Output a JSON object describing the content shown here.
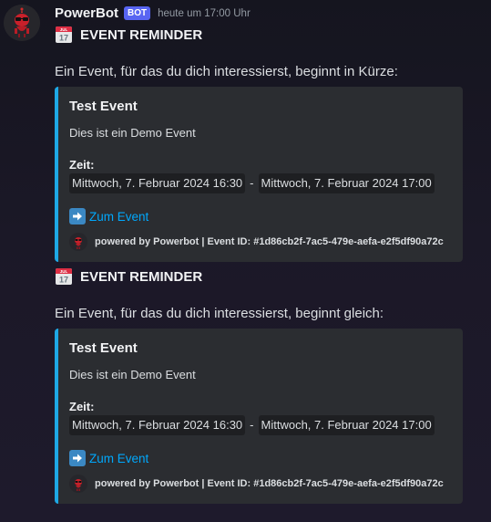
{
  "message": {
    "author": "PowerBot",
    "bot_tag": "BOT",
    "timestamp": "heute um 17:00 Uhr",
    "avatar_icon": "robot-mascot-icon"
  },
  "reminders": [
    {
      "heading": "EVENT REMINDER",
      "intro": "Ein Event, für das du dich interessierst, beginnt in Kürze:",
      "embed": {
        "accent_color": "#1ea8e5",
        "title": "Test Event",
        "description": "Dies ist ein Demo Event",
        "field_name": "Zeit:",
        "start": "Mittwoch, 7. Februar 2024 16:30",
        "separator": "-",
        "end": "Mittwoch, 7. Februar 2024 17:00",
        "link_label": "Zum Event",
        "footer": "powered by Powerbot | Event ID: #1d86cb2f-7ac5-479e-aefa-e2f5df90a72c"
      }
    },
    {
      "heading": "EVENT REMINDER",
      "intro": "Ein Event, für das du dich interessierst, beginnt gleich:",
      "embed": {
        "accent_color": "#1ea8e5",
        "title": "Test Event",
        "description": "Dies ist ein Demo Event",
        "field_name": "Zeit:",
        "start": "Mittwoch, 7. Februar 2024 16:30",
        "separator": "-",
        "end": "Mittwoch, 7. Februar 2024 17:00",
        "link_label": "Zum Event",
        "footer": "powered by Powerbot | Event ID: #1d86cb2f-7ac5-479e-aefa-e2f5df90a72c"
      }
    }
  ],
  "calendar_icon": {
    "name": "calendar-icon",
    "month": "JUL",
    "day": "17"
  }
}
